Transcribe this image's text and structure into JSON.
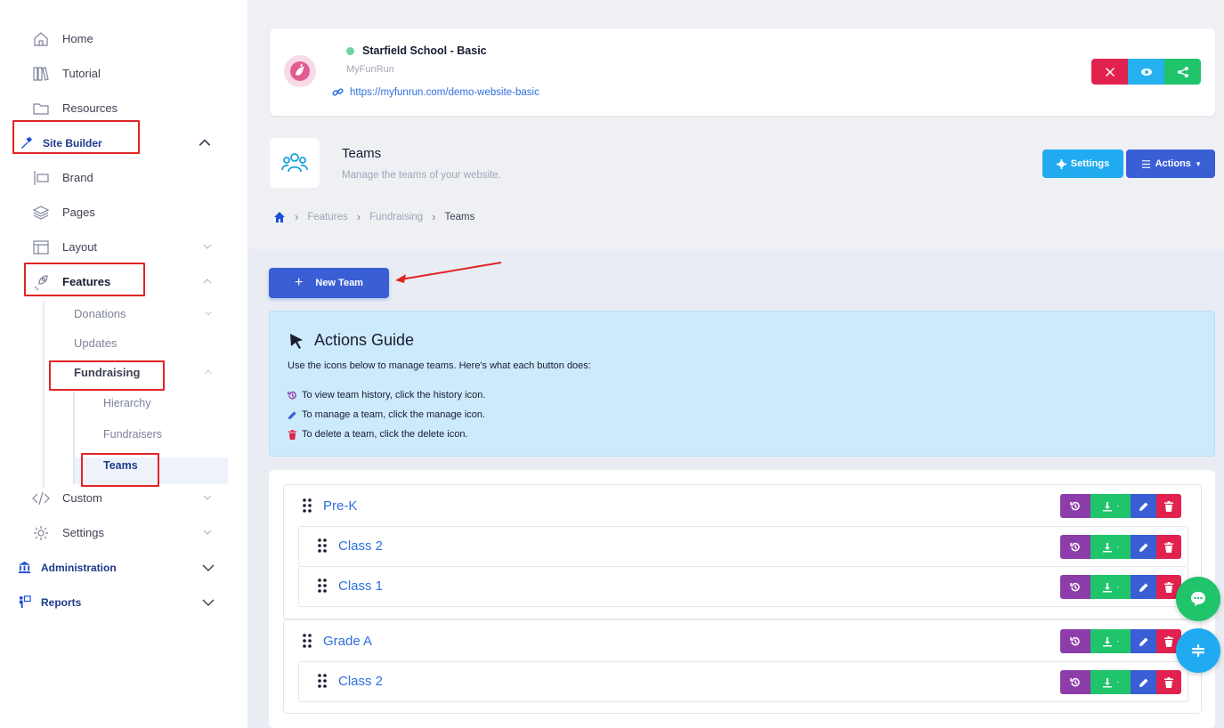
{
  "sidebar": {
    "home": "Home",
    "tutorial": "Tutorial",
    "resources": "Resources",
    "site_builder": "Site Builder",
    "brand": "Brand",
    "pages": "Pages",
    "layout": "Layout",
    "features": "Features",
    "donations": "Donations",
    "updates": "Updates",
    "fundraising": "Fundraising",
    "hierarchy": "Hierarchy",
    "fundraisers": "Fundraisers",
    "teams": "Teams",
    "custom": "Custom",
    "settings": "Settings",
    "administration": "Administration",
    "reports": "Reports"
  },
  "site": {
    "name": "Starfield School - Basic",
    "subtitle": "MyFunRun",
    "url": "https://myfunrun.com/demo-website-basic",
    "status_color": "#6fd3a4"
  },
  "page": {
    "title": "Teams",
    "subtitle": "Manage the teams of your website.",
    "settings_label": "Settings",
    "actions_label": "Actions"
  },
  "breadcrumb": [
    "Features",
    "Fundraising",
    "Teams"
  ],
  "new_team_label": "New Team",
  "guide": {
    "title": "Actions Guide",
    "intro": "Use the icons below to manage teams. Here's what each button does:",
    "lines": [
      "To view team history, click the history icon.",
      "To manage a team, click the manage icon.",
      "To delete a team, click the delete icon."
    ]
  },
  "teams": [
    {
      "name": "Pre-K",
      "children": [
        "Class 2",
        "Class 1"
      ]
    },
    {
      "name": "Grade A",
      "children": [
        "Class 2"
      ]
    }
  ],
  "colors": {
    "primary": "#3a5fd4",
    "info": "#20aaf0",
    "success": "#1fc46b",
    "danger": "#e1224f",
    "history": "#8c3da9",
    "highlight": "#e02424"
  }
}
